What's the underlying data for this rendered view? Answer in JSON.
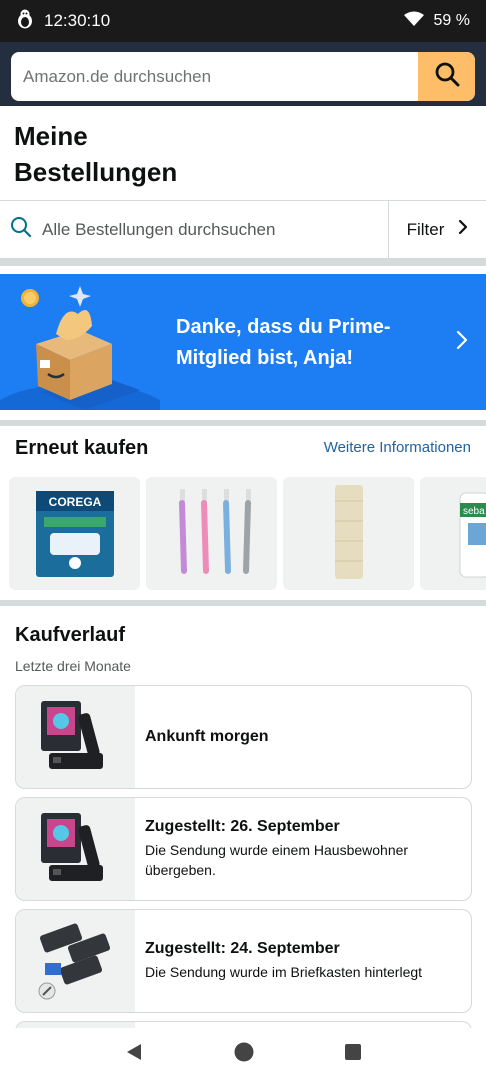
{
  "status_bar": {
    "time": "12:30:10",
    "battery": "59 %"
  },
  "search": {
    "placeholder": "Amazon.de durchsuchen"
  },
  "page": {
    "title_line1": "Meine",
    "title_line2": "Bestellungen"
  },
  "orders_search": {
    "placeholder": "Alle Bestellungen durchsuchen",
    "filter_label": "Filter"
  },
  "prime_banner": {
    "line1": "Danke, dass du Prime-",
    "line2": "Mitglied bist, Anja!"
  },
  "buy_again": {
    "title": "Erneut kaufen",
    "link": "Weitere Informationen",
    "products": [
      {
        "icon": "corega-box",
        "label": "COREGA"
      },
      {
        "icon": "toothbrushes",
        "label": ""
      },
      {
        "icon": "scratching-post",
        "label": ""
      },
      {
        "icon": "sebamed-bottle",
        "label": "seba"
      }
    ]
  },
  "history": {
    "title": "Kaufverlauf",
    "subtitle": "Letzte drei Monate",
    "orders": [
      {
        "status": "Ankunft morgen",
        "desc_line1": "",
        "desc_line2": "",
        "icon": "hdmi-switch"
      },
      {
        "status": "Zugestellt: 26. September",
        "desc_line1": "Die Sendung wurde einem Hausbewohner",
        "desc_line2": "übergeben.",
        "icon": "hdmi-switch"
      },
      {
        "status": "Zugestellt: 24. September",
        "desc_line1": "Die Sendung wurde im Briefkasten hinterlegt",
        "desc_line2": "",
        "icon": "usb-adapters"
      }
    ]
  },
  "colors": {
    "header_bg": "#232f3e",
    "search_button": "#febd69",
    "prime_blue": "#1d7df2",
    "link_blue": "#2162a1"
  }
}
